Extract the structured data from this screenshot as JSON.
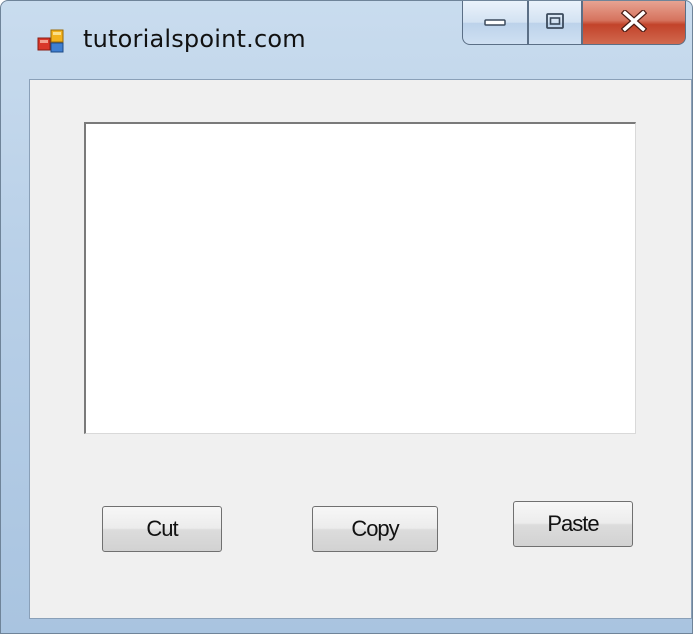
{
  "window": {
    "title": "tutorialspoint.com"
  },
  "caption_buttons": {
    "minimize_icon": "minimize-icon",
    "maximize_icon": "maximize-icon",
    "close_icon": "close-icon"
  },
  "textbox": {
    "value": ""
  },
  "buttons": {
    "cut_label": "Cut",
    "copy_label": "Copy",
    "paste_label": "Paste"
  },
  "colors": {
    "client_background": "#f0f0f0",
    "close_button": "#c2432a",
    "titlebar": "#b9d0e8"
  }
}
